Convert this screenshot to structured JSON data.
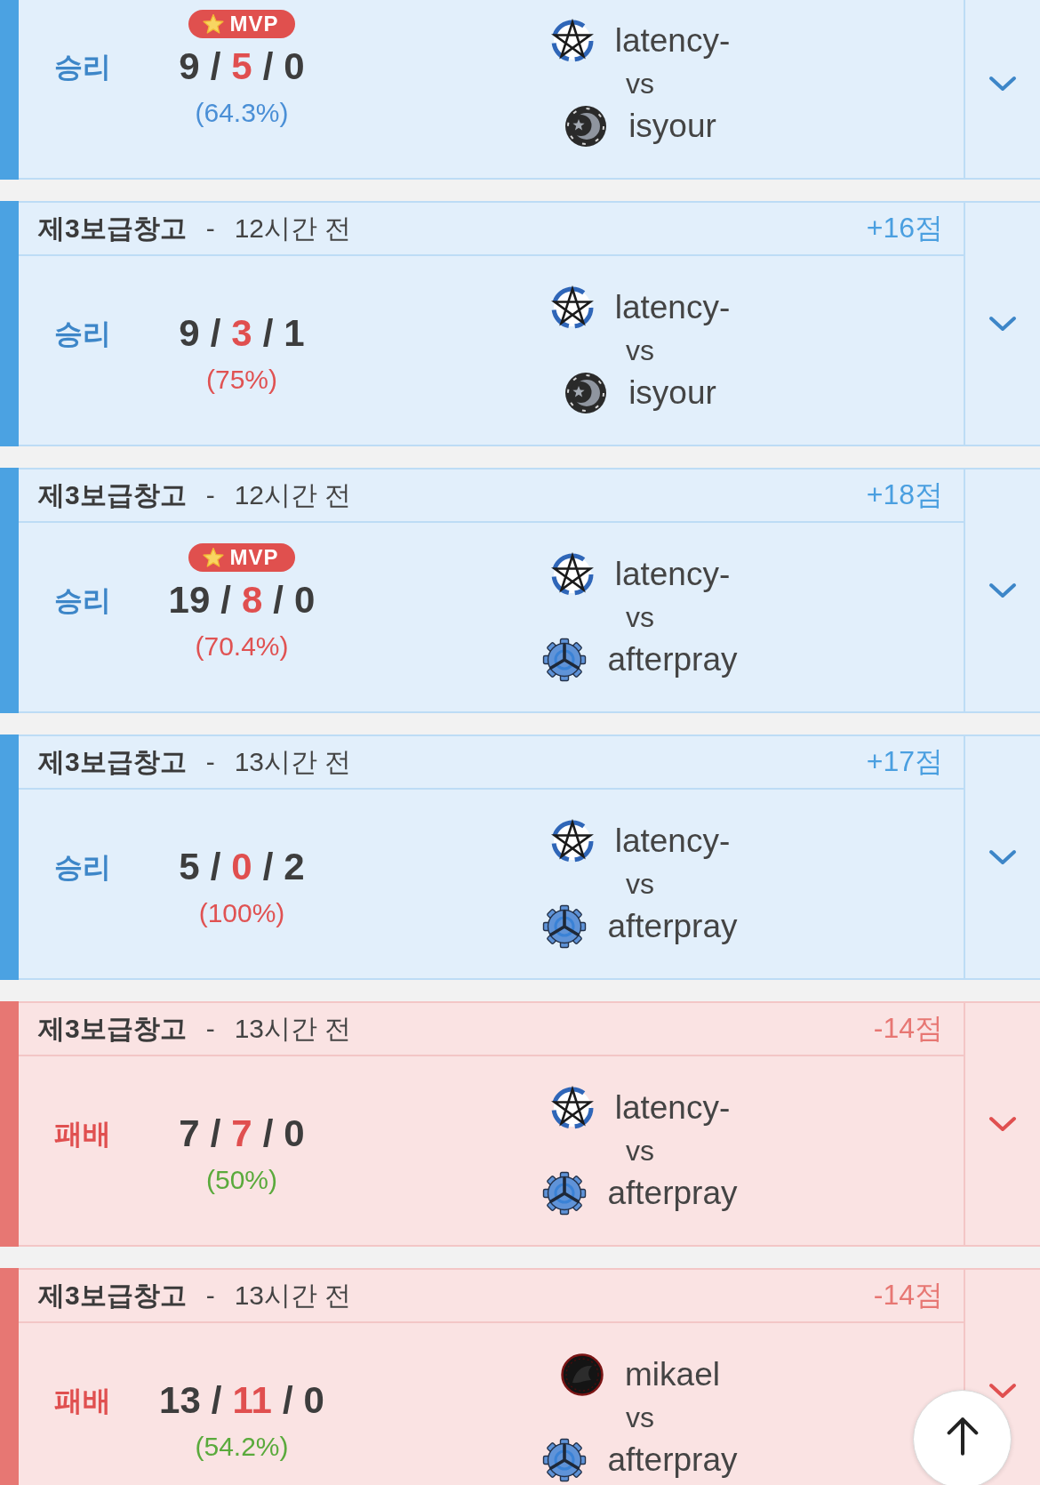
{
  "matches": [
    {
      "kind": "win",
      "result": "승리",
      "badge": "MVP",
      "kda": [
        {
          "kind": "kills",
          "text": "9"
        },
        {
          "kind": "sep",
          "text": "/"
        },
        {
          "kind": "deaths",
          "text": "5"
        },
        {
          "kind": "sep",
          "text": "/"
        },
        {
          "kind": "assists",
          "text": "0"
        }
      ],
      "participation": {
        "text": "(64.3%)",
        "color": "#4a8fd6"
      },
      "players": [
        {
          "kind": "pentagram",
          "name": "latency-"
        },
        {
          "kind": "crescent",
          "name": "isyour"
        }
      ],
      "versus": "vs",
      "expanded": false
    },
    {
      "kind": "win",
      "header": {
        "map": "제3보급창고",
        "separator": "-",
        "time": "12시간 전",
        "points": "+16점"
      },
      "result": "승리",
      "kda": [
        {
          "kind": "kills",
          "text": "9"
        },
        {
          "kind": "sep",
          "text": "/"
        },
        {
          "kind": "deaths",
          "text": "3"
        },
        {
          "kind": "sep",
          "text": "/"
        },
        {
          "kind": "assists",
          "text": "1"
        }
      ],
      "participation": {
        "text": "(75%)",
        "color": "#e05252"
      },
      "players": [
        {
          "kind": "pentagram",
          "name": "latency-"
        },
        {
          "kind": "crescent",
          "name": "isyour"
        }
      ],
      "versus": "vs",
      "expanded": false
    },
    {
      "kind": "win",
      "header": {
        "map": "제3보급창고",
        "separator": "-",
        "time": "12시간 전",
        "points": "+18점"
      },
      "result": "승리",
      "badge": "MVP",
      "kda": [
        {
          "kind": "kills",
          "text": "19"
        },
        {
          "kind": "sep",
          "text": "/"
        },
        {
          "kind": "deaths",
          "text": "8"
        },
        {
          "kind": "sep",
          "text": "/"
        },
        {
          "kind": "assists",
          "text": "0"
        }
      ],
      "participation": {
        "text": "(70.4%)",
        "color": "#e05252"
      },
      "players": [
        {
          "kind": "pentagram",
          "name": "latency-"
        },
        {
          "kind": "trigear",
          "name": "afterpray"
        }
      ],
      "versus": "vs",
      "expanded": false
    },
    {
      "kind": "win",
      "header": {
        "map": "제3보급창고",
        "separator": "-",
        "time": "13시간 전",
        "points": "+17점"
      },
      "result": "승리",
      "kda": [
        {
          "kind": "kills",
          "text": "5"
        },
        {
          "kind": "sep",
          "text": "/"
        },
        {
          "kind": "deaths",
          "text": "0"
        },
        {
          "kind": "sep",
          "text": "/"
        },
        {
          "kind": "assists",
          "text": "2"
        }
      ],
      "participation": {
        "text": "(100%)",
        "color": "#e05252"
      },
      "players": [
        {
          "kind": "pentagram",
          "name": "latency-"
        },
        {
          "kind": "trigear",
          "name": "afterpray"
        }
      ],
      "versus": "vs",
      "expanded": false
    },
    {
      "kind": "loss",
      "header": {
        "map": "제3보급창고",
        "separator": "-",
        "time": "13시간 전",
        "points": "-14점"
      },
      "result": "패배",
      "kda": [
        {
          "kind": "kills",
          "text": "7"
        },
        {
          "kind": "sep",
          "text": "/"
        },
        {
          "kind": "deaths",
          "text": "7"
        },
        {
          "kind": "sep",
          "text": "/"
        },
        {
          "kind": "assists",
          "text": "0"
        }
      ],
      "participation": {
        "text": "(50%)",
        "color": "#5aaa3c"
      },
      "players": [
        {
          "kind": "pentagram",
          "name": "latency-"
        },
        {
          "kind": "trigear",
          "name": "afterpray"
        }
      ],
      "versus": "vs",
      "expanded": false
    },
    {
      "kind": "loss",
      "header": {
        "map": "제3보급창고",
        "separator": "-",
        "time": "13시간 전",
        "points": "-14점"
      },
      "result": "패배",
      "kda": [
        {
          "kind": "kills",
          "text": "13"
        },
        {
          "kind": "sep",
          "text": "/"
        },
        {
          "kind": "deaths",
          "text": "11"
        },
        {
          "kind": "sep",
          "text": "/"
        },
        {
          "kind": "assists",
          "text": "0"
        }
      ],
      "participation": {
        "text": "(54.2%)",
        "color": "#5aaa3c"
      },
      "players": [
        {
          "kind": "crest",
          "name": "mikael"
        },
        {
          "kind": "trigear",
          "name": "afterpray"
        }
      ],
      "versus": "vs",
      "expanded": false
    }
  ]
}
